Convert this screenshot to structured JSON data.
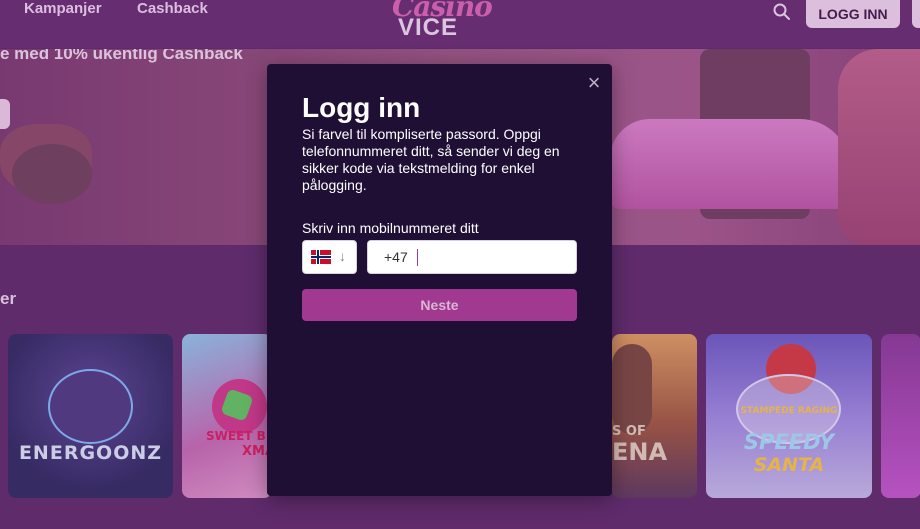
{
  "header": {
    "nav": [
      "Kampanjer",
      "Cashback"
    ],
    "logo_script": "Casino",
    "logo_main": "VICE",
    "login_label": "LOGG INN",
    "search_icon": "search-icon"
  },
  "banner": {
    "text": "e med 10% ukentlig Cashback"
  },
  "section": {
    "title": "er"
  },
  "games": [
    {
      "label": "ENERGOONZ"
    },
    {
      "label": "SWEET B",
      "sub": "XMA"
    },
    {
      "label": "S OF",
      "sub": "ENA"
    },
    {
      "label": "SPEEDY",
      "sub": "SANTA",
      "top": "STAMPEDE RAGING"
    }
  ],
  "modal": {
    "title": "Logg inn",
    "description": "Si farvel til kompliserte passord. Oppgi telefonnummeret ditt, så sender vi deg en sikker kode via tekstmelding for enkel pålogging.",
    "field_label": "Skriv inn mobilnummeret ditt",
    "country_code": "+47",
    "submit_label": "Neste",
    "close_icon": "close-icon"
  },
  "colors": {
    "accent": "#a0398f",
    "modal_bg": "#1f0f35",
    "page_bg": "#5c2a68"
  }
}
